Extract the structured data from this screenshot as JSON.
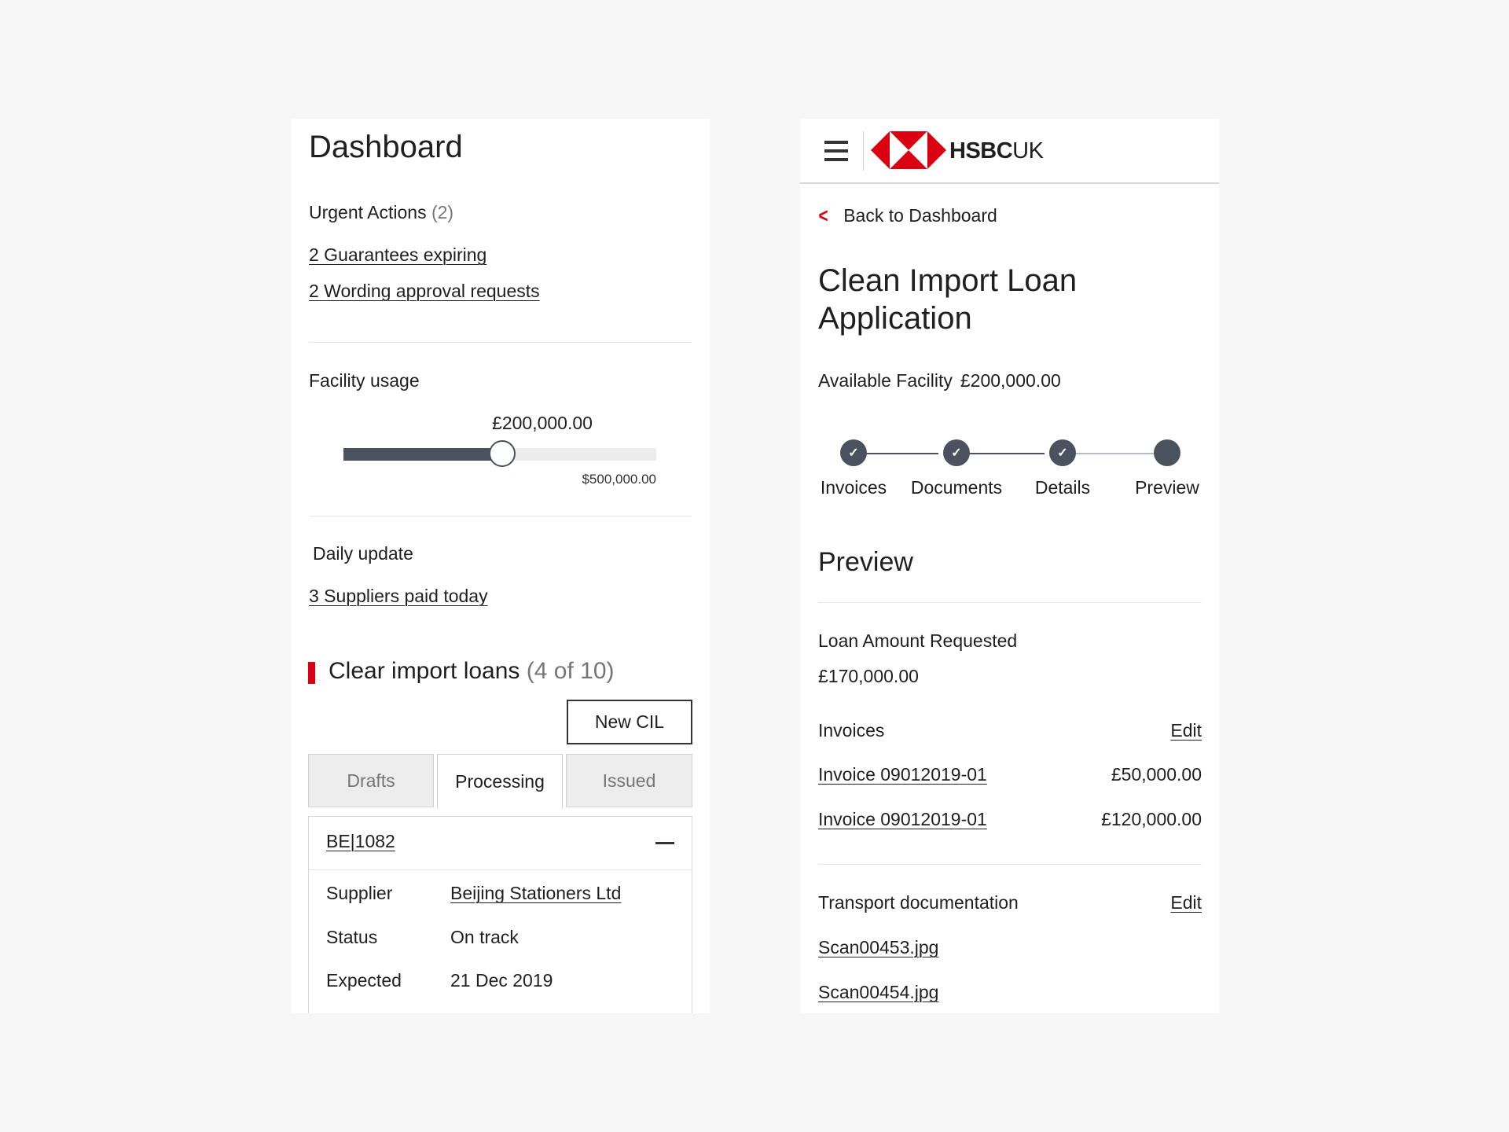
{
  "dashboard": {
    "title": "Dashboard",
    "urgent_label": "Urgent Actions",
    "urgent_count": "(2)",
    "urgent_links": [
      "2 Guarantees expiring",
      "2 Wording approval requests"
    ],
    "facility_label": "Facility usage",
    "facility_value": "£200,000.00",
    "facility_max": "$500,000.00",
    "facility_used_fraction": 0.4,
    "daily_label": "Daily update",
    "daily_link": "3 Suppliers paid today",
    "cil_title": "Clear import loans",
    "cil_count": "(4 of 10)",
    "new_button": "New CIL",
    "tabs": [
      "Drafts",
      "Processing",
      "Issued"
    ],
    "active_tab": "Processing",
    "card": {
      "ref": "BE|1082",
      "rows": [
        {
          "key": "Supplier",
          "value": "Beijing Stationers Ltd",
          "link": true
        },
        {
          "key": "Status",
          "value": "On track",
          "link": false
        },
        {
          "key": "Expected",
          "value": "21 Dec 2019",
          "link": false
        }
      ]
    }
  },
  "application": {
    "brand": "HSBC",
    "brand_suffix": "UK",
    "back_label": "Back to Dashboard",
    "title": "Clean Import Loan Application",
    "available_label": "Available Facility",
    "available_value": "£200,000.00",
    "steps": [
      {
        "label": "Invoices",
        "state": "done"
      },
      {
        "label": "Documents",
        "state": "done"
      },
      {
        "label": "Details",
        "state": "done"
      },
      {
        "label": "Preview",
        "state": "current"
      }
    ],
    "section_title": "Preview",
    "loan_label": "Loan Amount Requested",
    "loan_value": "£170,000.00",
    "invoices_label": "Invoices",
    "edit_label": "Edit",
    "invoices": [
      {
        "name": "Invoice 09012019-01",
        "amount": "£50,000.00"
      },
      {
        "name": "Invoice 09012019-01",
        "amount": "£120,000.00"
      }
    ],
    "transport_label": "Transport documentation",
    "documents": [
      "Scan00453.jpg",
      "Scan00454.jpg"
    ]
  },
  "colors": {
    "accent_red": "#db0011",
    "slate": "#4a5260",
    "background": "#f6f6f6"
  }
}
